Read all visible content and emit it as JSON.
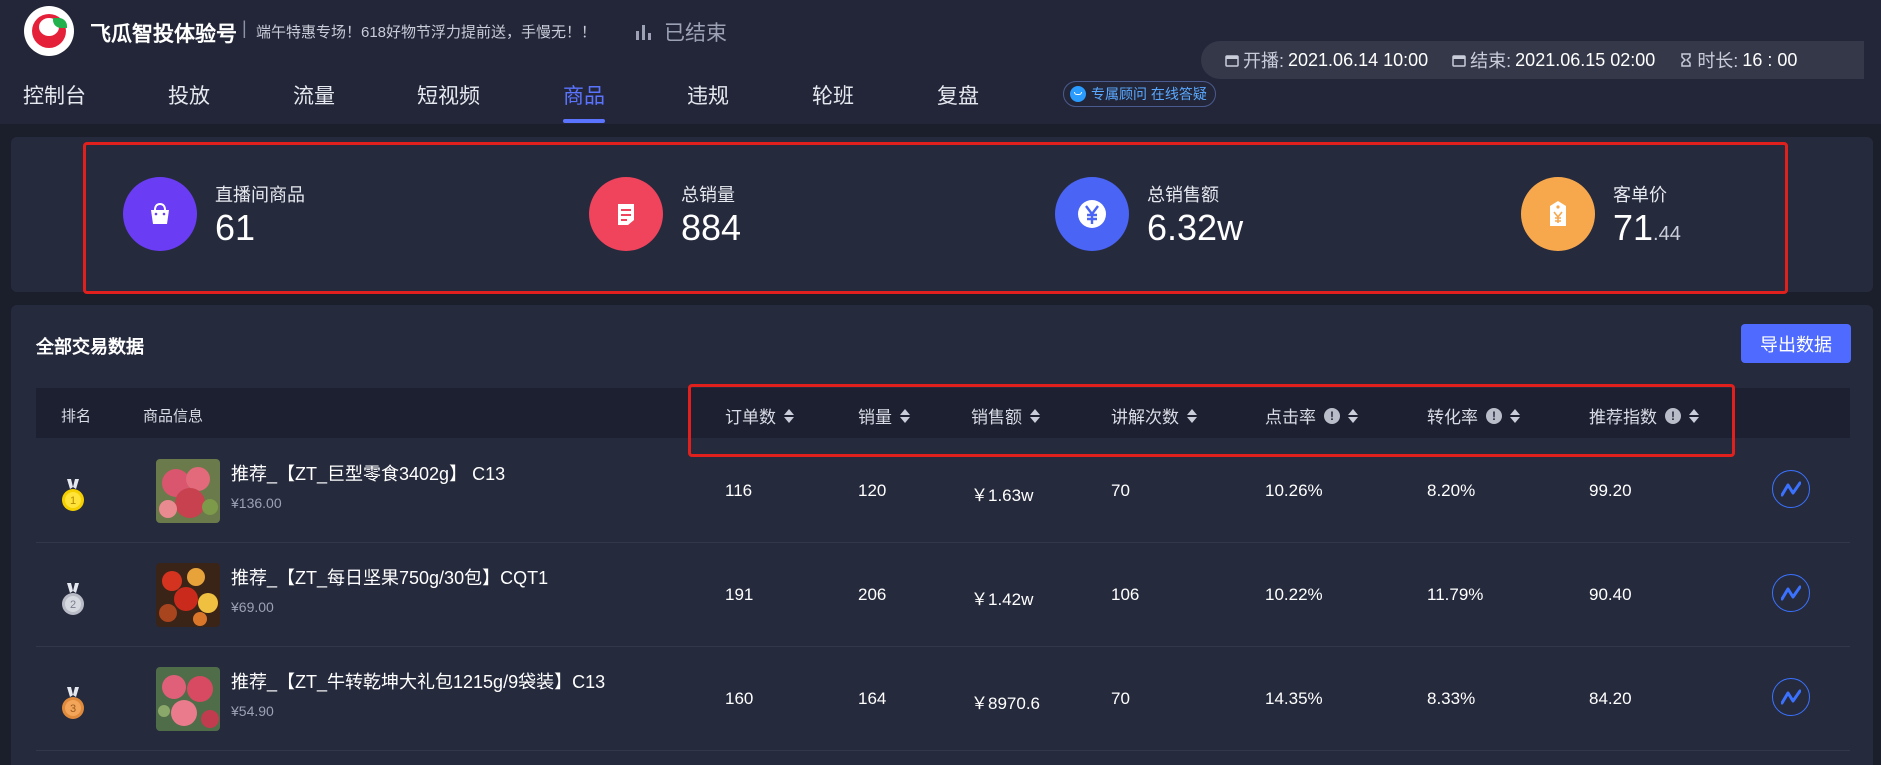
{
  "header": {
    "brand": "飞瓜智投体验号",
    "separator": "|",
    "promo": "端午特惠专场！618好物节浮力提前送，手慢无！！",
    "status": "已结束",
    "start_label": "开播:",
    "start_value": "2021.06.14 10:00",
    "end_label": "结束:",
    "end_value": "2021.06.15 02:00",
    "duration_label": "时长:",
    "duration_value": "16 : 00"
  },
  "nav": {
    "tabs": [
      {
        "label": "控制台"
      },
      {
        "label": "投放"
      },
      {
        "label": "流量"
      },
      {
        "label": "短视频"
      },
      {
        "label": "商品",
        "active": true
      },
      {
        "label": "违规"
      },
      {
        "label": "轮班"
      },
      {
        "label": "复盘"
      }
    ],
    "consult": "专属顾问 在线答疑"
  },
  "stats": [
    {
      "label": "直播间商品",
      "value": "61",
      "color": "#6a3df5",
      "icon": "shopping-bag-icon"
    },
    {
      "label": "总销量",
      "value": "884",
      "color": "#f0435c",
      "icon": "receipt-icon"
    },
    {
      "label": "总销售额",
      "value": "6.32w",
      "color": "#4a64f5",
      "icon": "yuan-icon"
    },
    {
      "label": "客单价",
      "value": "71",
      "value_decimal": ".44",
      "color": "#f7a84d",
      "icon": "price-tag-icon"
    }
  ],
  "table": {
    "title": "全部交易数据",
    "export_label": "导出数据",
    "headers": {
      "rank": "排名",
      "product": "商品信息",
      "orders": "订单数",
      "sales": "销量",
      "revenue": "销售额",
      "explain": "讲解次数",
      "ctr": "点击率",
      "cvr": "转化率",
      "score": "推荐指数"
    },
    "rows": [
      {
        "rank": "1",
        "medal": "gold",
        "name": "推荐_【ZT_巨型零食3402g】 C13",
        "price": "¥136.00",
        "orders": "116",
        "sales": "120",
        "revenue": "￥1.63w",
        "explain": "70",
        "ctr": "10.26%",
        "cvr": "8.20%",
        "score": "99.20"
      },
      {
        "rank": "2",
        "medal": "silver",
        "name": "推荐_【ZT_每日坚果750g/30包】CQT1",
        "price": "¥69.00",
        "orders": "191",
        "sales": "206",
        "revenue": "￥1.42w",
        "explain": "106",
        "ctr": "10.22%",
        "cvr": "11.79%",
        "score": "90.40"
      },
      {
        "rank": "3",
        "medal": "bronze",
        "name": "推荐_【ZT_牛转乾坤大礼包1215g/9袋装】C13",
        "price": "¥54.90",
        "orders": "160",
        "sales": "164",
        "revenue": "￥8970.6",
        "explain": "70",
        "ctr": "14.35%",
        "cvr": "8.33%",
        "score": "84.20"
      }
    ]
  }
}
